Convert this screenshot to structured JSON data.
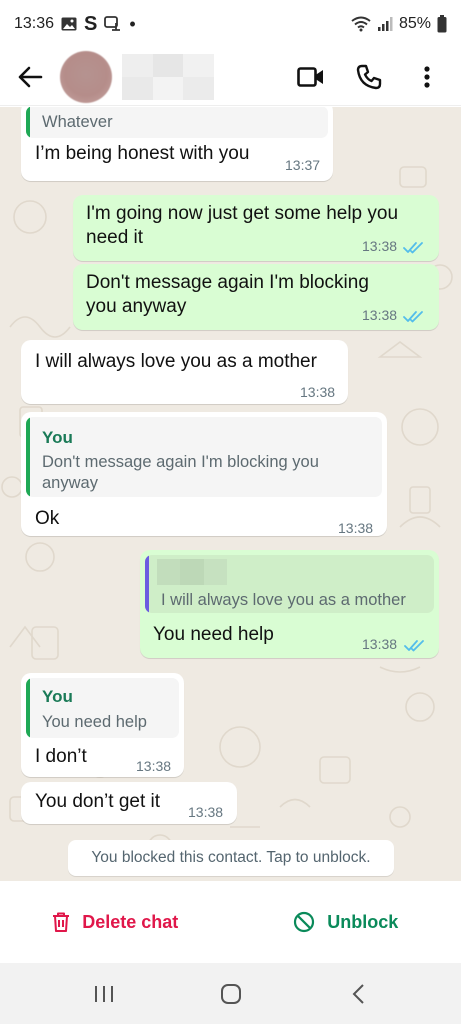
{
  "status_bar": {
    "time": "13:36",
    "carrier_letter": "S",
    "dot": "•",
    "battery": "85%"
  },
  "header": {
    "contact_name_redacted": true
  },
  "messages": [
    {
      "direction": "in",
      "quote_text": "Whatever",
      "text": "I’m being honest with you",
      "time": "13:37"
    },
    {
      "direction": "out",
      "text_line1": "I'm going now just get some help you",
      "text_line2": "need it",
      "time": "13:38",
      "status": "read"
    },
    {
      "direction": "out",
      "text_line1": "Don't message again I'm blocking",
      "text_line2": "you anyway",
      "time": "13:38",
      "status": "read"
    },
    {
      "direction": "in",
      "text": "I will always love you as a mother",
      "time": "13:38"
    },
    {
      "direction": "in",
      "quote_author": "You",
      "quote_line1": "Don't message again I'm blocking you",
      "quote_line2": "anyway",
      "text": "Ok",
      "time": "13:38"
    },
    {
      "direction": "out",
      "quote_text": "I will always love you as a mother",
      "text": "You need help",
      "time": "13:38",
      "status": "read"
    },
    {
      "direction": "in",
      "quote_author": "You",
      "quote_text": "You need help",
      "text": "I don’t",
      "time": "13:38"
    },
    {
      "direction": "in",
      "text": "You don’t get it",
      "time": "13:38"
    }
  ],
  "system_message": "You blocked this contact. Tap to unblock.",
  "actions": {
    "delete_label": "Delete chat",
    "unblock_label": "Unblock"
  },
  "colors": {
    "incoming_bubble": "#ffffff",
    "outgoing_bubble": "#d9fdd3",
    "read_tick": "#53bdeb",
    "delete": "#e0174a",
    "unblock": "#0a8a5a",
    "quote_author": "#1a7a57",
    "quote_bar_green": "#1fa855",
    "quote_bar_purple": "#6b5ce0",
    "chat_background": "#efeae2"
  },
  "icons": {
    "back": "arrow-left-icon",
    "video": "video-camera-icon",
    "call": "phone-icon",
    "menu": "more-vertical-icon",
    "delete": "trash-icon",
    "unblock": "block-icon"
  }
}
